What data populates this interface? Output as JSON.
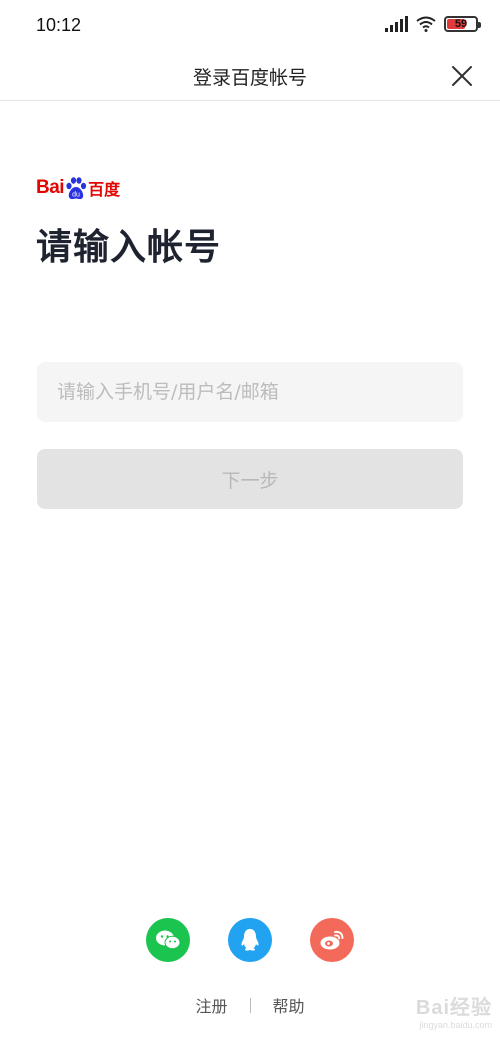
{
  "status_bar": {
    "time": "10:12",
    "battery": "59"
  },
  "nav": {
    "title": "登录百度帐号"
  },
  "brand": {
    "latin": "Bai",
    "chinese": "百度",
    "paw_text": "du"
  },
  "heading": "请输入帐号",
  "account_input": {
    "placeholder": "请输入手机号/用户名/邮箱",
    "value": ""
  },
  "next_button": {
    "label": "下一步"
  },
  "social_login": [
    "wechat-icon",
    "qq-icon",
    "weibo-icon"
  ],
  "footer": {
    "register": "注册",
    "help": "帮助"
  },
  "watermark": {
    "main": "Bai经验",
    "sub": "jingyan.baidu.com"
  },
  "colors": {
    "brand_red": "#e10602",
    "wechat": "#1bc34f",
    "qq": "#21a3f1",
    "weibo": "#f36a5a"
  }
}
